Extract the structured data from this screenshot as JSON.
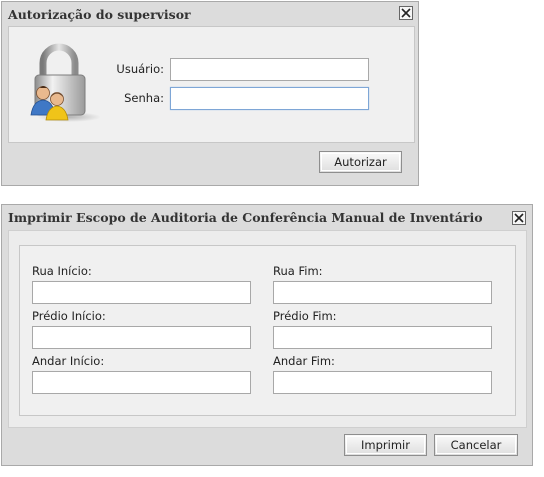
{
  "supervisor_dialog": {
    "title": "Autorização do supervisor",
    "usuario_label": "Usuário:",
    "usuario_value": "",
    "senha_label": "Senha:",
    "senha_value": "",
    "authorize_button": "Autorizar",
    "icon": "lock-users-icon"
  },
  "print_dialog": {
    "title": "Imprimir Escopo de Auditoria de Conferência Manual de Inventário",
    "fields": {
      "rua_inicio_label": "Rua Início:",
      "rua_fim_label": "Rua Fim:",
      "predio_inicio_label": "Prédio Início:",
      "predio_fim_label": "Prédio Fim:",
      "andar_inicio_label": "Andar Início:",
      "andar_fim_label": "Andar Fim:"
    },
    "print_button": "Imprimir",
    "cancel_button": "Cancelar"
  },
  "colors": {
    "dialog_background": "#dcdcdc",
    "panel_background": "#f0f0f0",
    "focus_border": "#7ea6d6"
  }
}
